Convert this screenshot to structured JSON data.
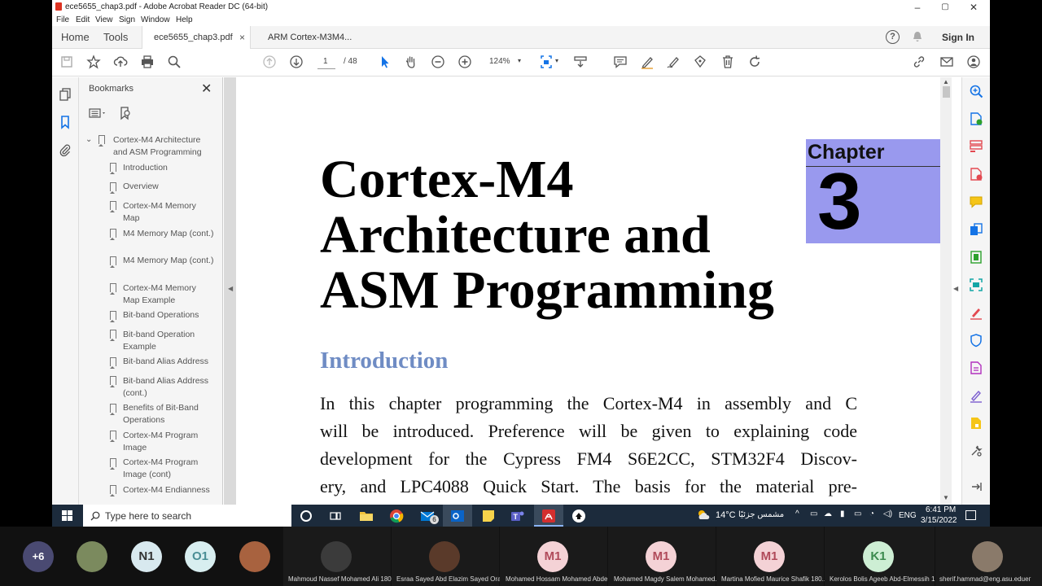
{
  "window": {
    "title": "ece5655_chap3.pdf - Adobe Acrobat Reader DC (64-bit)",
    "controls": {
      "minimize": "–",
      "maximize": "▢",
      "close": "✕"
    }
  },
  "menu": [
    "File",
    "Edit",
    "View",
    "Sign",
    "Window",
    "Help"
  ],
  "tabs": {
    "home": "Home",
    "tools": "Tools",
    "documents": [
      {
        "label": "ece5655_chap3.pdf",
        "close": "×",
        "active": true
      },
      {
        "label": "ARM Cortex-M3M4...",
        "active": false
      }
    ],
    "sign_in": "Sign In"
  },
  "toolbar": {
    "page_current": "1",
    "page_total": "/ 48",
    "zoom": "124%"
  },
  "bookmarks": {
    "header": "Bookmarks",
    "close": "✕",
    "root": "Cortex-M4 Architecture and ASM Programming",
    "items": [
      "Introduction",
      "Overview",
      "Cortex-M4 Memory Map",
      "M4 Memory Map (cont.)",
      "M4 Memory Map (cont.)",
      "Cortex-M4 Memory Map Example",
      "Bit-band Operations",
      "Bit-band Operation Example",
      "Bit-band Alias Address",
      "Bit-band Alias Address (cont.)",
      "Benefits of Bit-Band Operations",
      "Cortex-M4 Program Image",
      "Cortex-M4 Program Image (cont)",
      "Cortex-M4 Endianness"
    ]
  },
  "document": {
    "title_lines": [
      "Cortex-M4",
      "Architecture and",
      "ASM Programming"
    ],
    "chapter_label": "Chapter",
    "chapter_number": "3",
    "section_heading": "Introduction",
    "body_lines": [
      "In this chapter programming the Cortex-M4 in assembly and C",
      "will be introduced. Preference will be given to explaining code",
      "development for the Cypress FM4 S6E2CC, STM32F4 Discov-",
      "ery, and LPC4088 Quick Start. The basis for the material pre-"
    ]
  },
  "taskbar": {
    "search_placeholder": "Type here to search",
    "mail_badge": "6",
    "weather": "14°C",
    "weather_text": "مشمس جزئيًا",
    "language": "ENG",
    "time": "6:41 PM",
    "date": "3/15/2022"
  },
  "meeting": {
    "more_count": "+6",
    "participants_small": [
      {
        "initials": "N1",
        "color": "#d8e9ef"
      },
      {
        "initials": "O1",
        "color": "#d8eef0"
      }
    ],
    "tiles": [
      {
        "name": "Mahmoud Nassef Mohamed Ali 180...",
        "initials": "",
        "color": "#2a2a2a"
      },
      {
        "name": "Esraa Sayed Abd Elazim Sayed Orab...",
        "initials": "",
        "color": "#2a2a2a"
      },
      {
        "name": "Mohamed Hossam Mohamed Abde...",
        "initials": "M1",
        "color": "#f4d2d6"
      },
      {
        "name": "Mohamed Magdy Salem Mohamed...",
        "initials": "M1",
        "color": "#f4d2d6"
      },
      {
        "name": "Martina Mofied Maurice Shafik 180...",
        "initials": "M1",
        "color": "#f4d2d6"
      },
      {
        "name": "Kerolos Bolis Ageeb Abd-Elmessih 1...",
        "initials": "K1",
        "color": "#cdeed4"
      },
      {
        "name": "sherif.hammad@eng.asu.eduег",
        "initials": "",
        "color": "#2a2a2a"
      }
    ]
  }
}
